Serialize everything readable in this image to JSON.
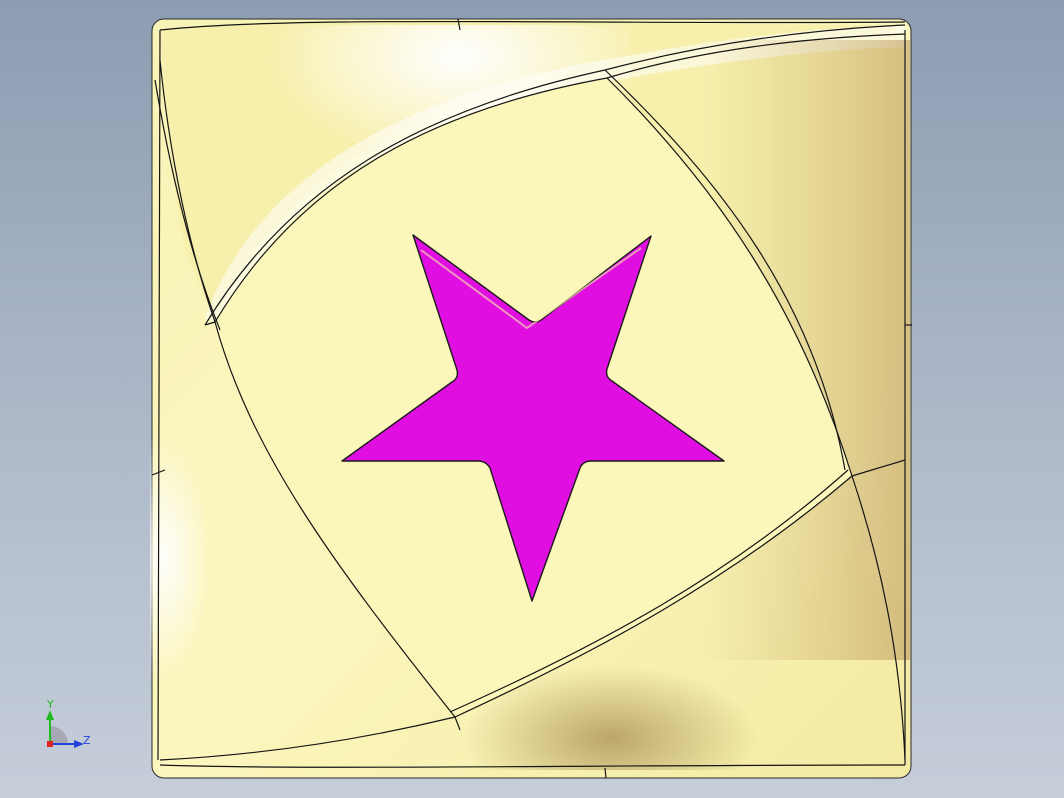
{
  "viewport": {
    "background_top": "#8c9cb1",
    "background_bottom": "#c6ceda"
  },
  "model": {
    "part_color": "#f6f0aa",
    "star_color": "#e00ee0",
    "edge_color": "#1a1a1a"
  },
  "triad": {
    "y_label": "Y",
    "z_label": "Z",
    "y_color": "#22b822",
    "z_color": "#2244dd",
    "origin_color": "#dd2222"
  }
}
